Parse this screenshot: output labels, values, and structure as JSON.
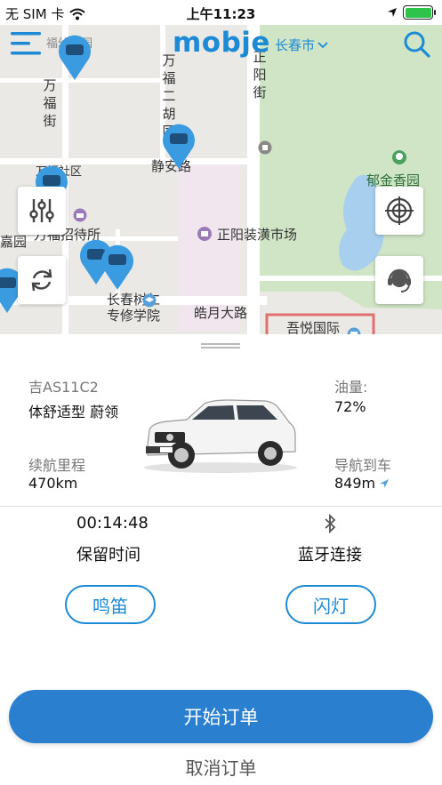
{
  "status_bar": {
    "carrier": "无 SIM 卡",
    "time": "上午11:23"
  },
  "header": {
    "logo": "mobje",
    "city": "长春市"
  },
  "map": {
    "labels": {
      "wanfu_street": "万福街",
      "wanfu_erhutong": "万福二胡同",
      "zhengyang_street": "正阳街",
      "community": "万福社区",
      "yujin_garden": "郁金香园",
      "zhaodaisuo": "万福招待所",
      "market": "正阳装潢市场",
      "jiayuan": "嘉园",
      "school": "长春树仁专修学院",
      "haoyue_road": "皓月大路",
      "wuyue_plaza": "吾悦国际",
      "jing_an_road": "静安路",
      "kindergarten": "福幼儿园"
    }
  },
  "car": {
    "plate": "吉AS11C2",
    "model": "体舒适型 蔚领",
    "fuel_label": "油量:",
    "fuel_value": "72%",
    "range_label": "续航里程",
    "range_value": "470km",
    "nav_label": "导航到车",
    "nav_value": "849m"
  },
  "reservation": {
    "timer": "00:14:48",
    "timer_label": "保留时间",
    "bluetooth_label": "蓝牙连接"
  },
  "actions": {
    "horn": "鸣笛",
    "flash": "闪灯",
    "start_order": "开始订单",
    "cancel_order": "取消订单"
  },
  "colors": {
    "brand_blue": "#1d8ad6",
    "primary_button": "#2a80cf",
    "battery_green": "#2ec34a",
    "park_green": "#cfe5c5",
    "water_blue": "#a9cfef"
  }
}
